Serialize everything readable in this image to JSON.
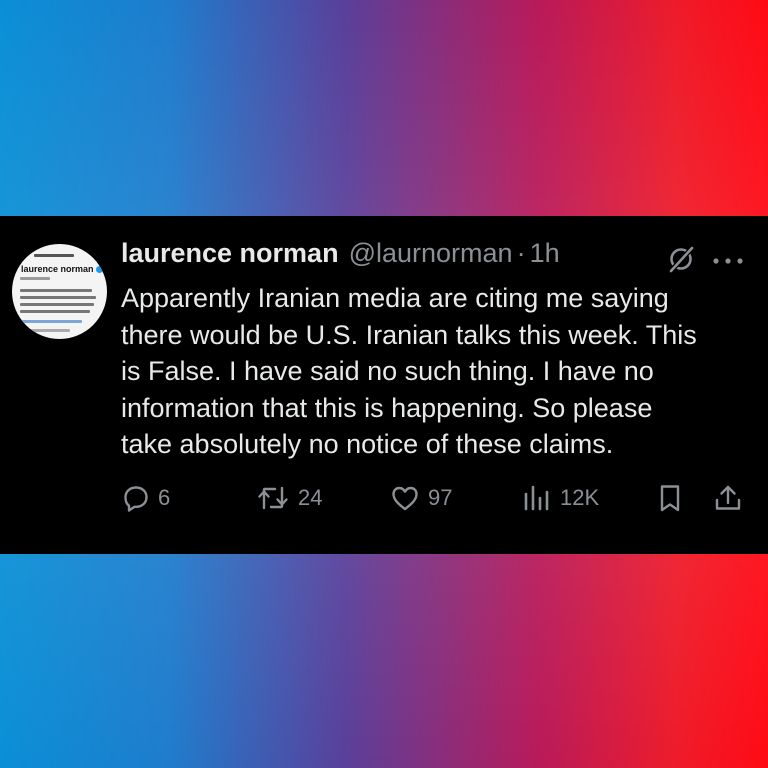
{
  "tweet": {
    "author_name": "laurence norman",
    "handle": "@laurnorman",
    "separator": "·",
    "time": "1h",
    "text_lines": [
      "Apparently Iranian media are citing me saying",
      "there would be U.S. Iranian talks this week. This",
      "is False. I have said no such thing. I have no",
      "information that this is happening. So please",
      "take absolutely no notice of these claims."
    ],
    "icons": {
      "grok": "grok-icon",
      "more": "more-icon"
    }
  },
  "avatar": {
    "name": "laurence norman"
  },
  "actions": {
    "replies": "6",
    "reposts": "24",
    "likes": "97",
    "views": "12K"
  },
  "colors": {
    "card_background": "#000000",
    "text_primary": "#e7e9ea",
    "text_secondary": "#8b9095",
    "verified_blue": "#1d9bf0",
    "gradient_left": "#0a8fd6",
    "gradient_right": "#ff0a14"
  }
}
